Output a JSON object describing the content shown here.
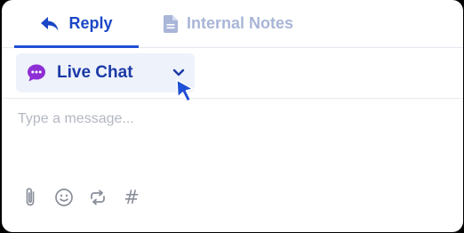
{
  "tabs": {
    "reply_label": "Reply",
    "notes_label": "Internal Notes",
    "active": "reply",
    "reply_icon": "reply-arrow-icon",
    "notes_icon": "document-icon"
  },
  "channel": {
    "label": "Live Chat",
    "icon": "chat-bubble-icon",
    "dropdown_icon": "chevron-down-icon"
  },
  "composer": {
    "placeholder": "Type a message...",
    "value": ""
  },
  "toolbar": {
    "icons": [
      "attachment-icon",
      "emoji-icon",
      "repeat-icon",
      "hashtag-icon"
    ],
    "hash_glyph": "#"
  },
  "colors": {
    "accent": "#1f4fd6",
    "accent_text": "#1b3aa6",
    "muted_tab": "#a9b6d8",
    "chat_icon": "#8e2fd6",
    "select_bg": "#eef2fb"
  }
}
